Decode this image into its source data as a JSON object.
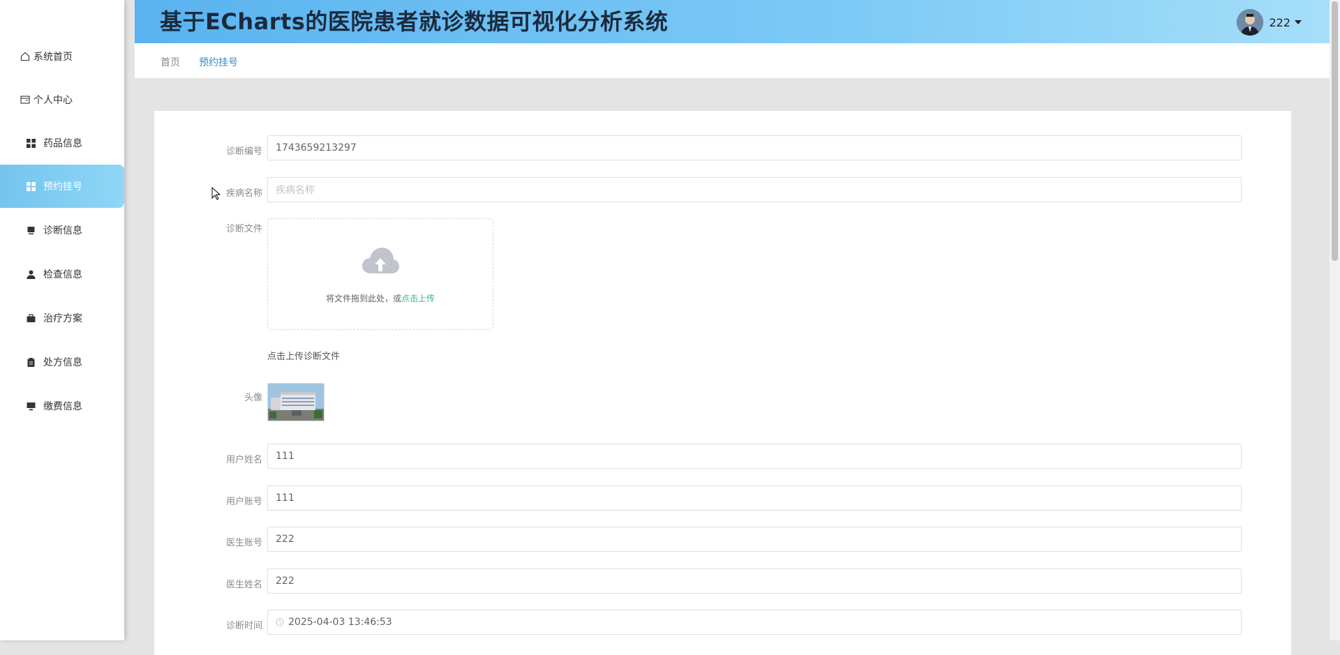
{
  "app": {
    "title": "基于ECharts的医院患者就诊数据可视化分析系统"
  },
  "user": {
    "name": "222"
  },
  "sidebar": {
    "items": [
      {
        "label": "系统首页",
        "icon": "home-icon"
      },
      {
        "label": "个人中心",
        "icon": "card-icon"
      },
      {
        "label": "药品信息",
        "icon": "grid-icon"
      },
      {
        "label": "预约挂号",
        "icon": "grid-icon",
        "active": true
      },
      {
        "label": "诊断信息",
        "icon": "monitor-icon"
      },
      {
        "label": "检查信息",
        "icon": "user-icon"
      },
      {
        "label": "治疗方案",
        "icon": "briefcase-icon"
      },
      {
        "label": "处方信息",
        "icon": "clipboard-icon"
      },
      {
        "label": "缴费信息",
        "icon": "desktop-icon"
      }
    ]
  },
  "breadcrumb": {
    "home": "首页",
    "current": "预约挂号"
  },
  "form": {
    "diag_no": {
      "label": "诊断编号",
      "value": "1743659213297"
    },
    "disease": {
      "label": "疾病名称",
      "placeholder": "疾病名称"
    },
    "file": {
      "label": "诊断文件",
      "drop_text": "将文件拖到此处，或",
      "link_text": "点击上传",
      "hint": "点击上传诊断文件"
    },
    "avatar": {
      "label": "头像"
    },
    "user_name": {
      "label": "用户姓名",
      "value": "111"
    },
    "user_account": {
      "label": "用户账号",
      "value": "111"
    },
    "doctor_account": {
      "label": "医生账号",
      "value": "222"
    },
    "doctor_name": {
      "label": "医生姓名",
      "value": "222"
    },
    "diag_time": {
      "label": "诊断时间",
      "value": "2025-04-03 13:46:53"
    }
  },
  "colors": {
    "accent": "#5ab3ef",
    "link": "#409eff",
    "upload_link": "#3bb37a"
  }
}
